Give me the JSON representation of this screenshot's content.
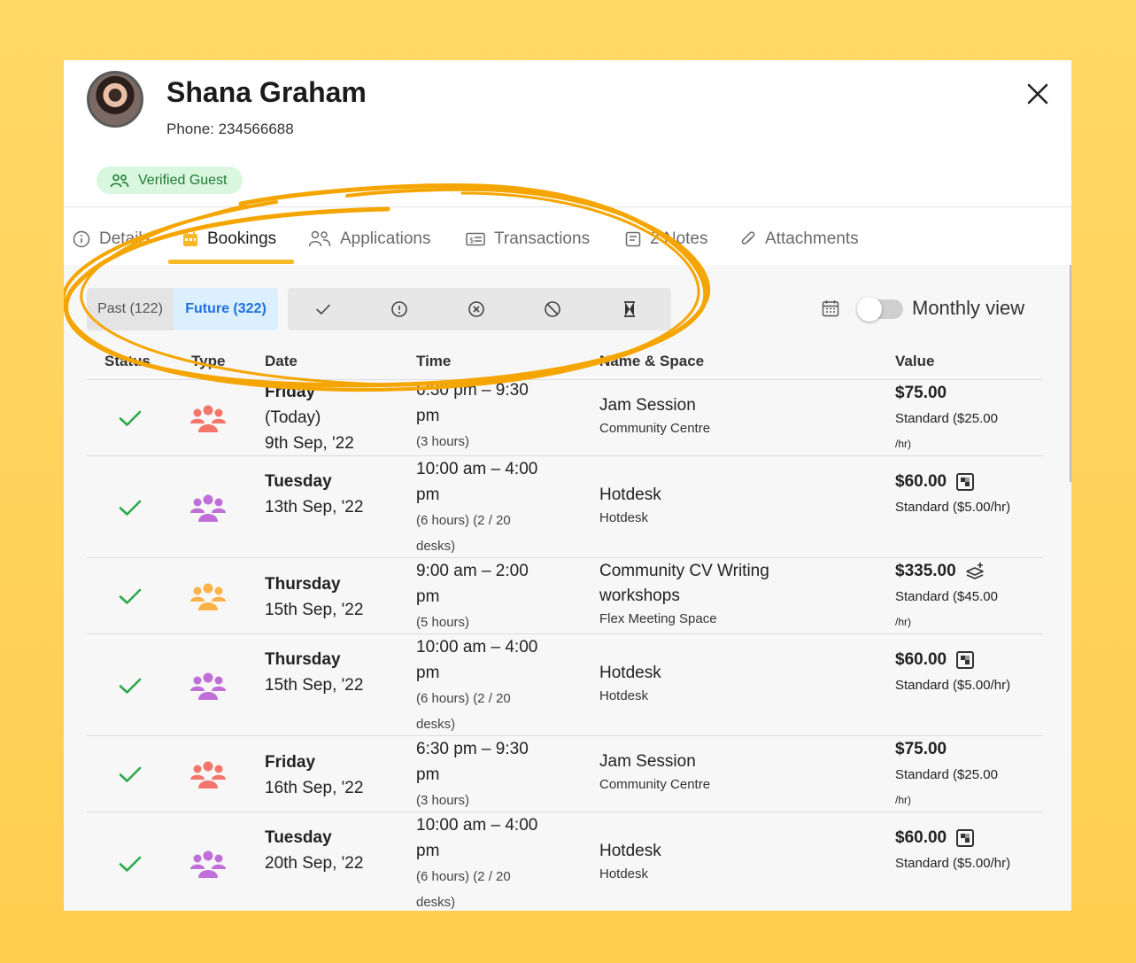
{
  "guest": {
    "name": "Shana Graham",
    "phone": "Phone: 234566688",
    "badge": "Verified Guest"
  },
  "tabs": [
    {
      "label": "Details",
      "icon": "info-icon",
      "active": false
    },
    {
      "label": "Bookings",
      "icon": "calendar-icon",
      "active": true
    },
    {
      "label": "Applications",
      "icon": "users-icon",
      "active": false
    },
    {
      "label": "Transactions",
      "icon": "receipt-icon",
      "active": false
    },
    {
      "label": "2 Notes",
      "icon": "note-icon",
      "active": false
    },
    {
      "label": "Attachments",
      "icon": "paperclip-icon",
      "active": false
    }
  ],
  "filters": {
    "past": "Past (122)",
    "future": "Future (322)",
    "statuses": [
      "check-icon",
      "alert-circle-icon",
      "x-circle-icon",
      "ban-icon",
      "hourglass-icon"
    ],
    "monthly_view": "Monthly view",
    "monthly_view_on": false
  },
  "table": {
    "headers": [
      "Status",
      "Type",
      "Date",
      "Time",
      "Name & Space",
      "Value"
    ],
    "rows": [
      {
        "type_color": "#f4756a",
        "date_lines": [
          "Friday",
          "(Today)",
          "9th Sep, '22"
        ],
        "time_lines": [
          "6:30 pm – 9:30",
          "pm"
        ],
        "time_detail": [
          "(3 hours)"
        ],
        "name": "Jam Session",
        "space": "Community Centre",
        "price": "$75.00",
        "price_icon": "",
        "rate_lines": [
          "Standard  ($25.00",
          "/hr)"
        ]
      },
      {
        "type_color": "#c06fd8",
        "date_lines": [
          "Tuesday",
          "13th Sep, '22"
        ],
        "time_lines": [
          "10:00 am – 4:00",
          "pm"
        ],
        "time_detail": [
          "(6 hours) (2 / 20",
          "desks)"
        ],
        "name": "Hotdesk",
        "space": "Hotdesk",
        "price": "$60.00",
        "price_icon": "desk-icon",
        "rate_lines": [
          "Standard  ($5.00/hr)"
        ]
      },
      {
        "type_color": "#fbb247",
        "date_lines": [
          "Thursday",
          "15th Sep, '22"
        ],
        "time_lines": [
          "9:00 am – 2:00",
          "pm"
        ],
        "time_detail": [
          "(5 hours)"
        ],
        "name": "Community CV Writing workshops",
        "space": "Flex Meeting Space",
        "price": "$335.00",
        "price_icon": "layers-plus-icon",
        "rate_lines": [
          "Standard  ($45.00",
          "/hr)"
        ]
      },
      {
        "type_color": "#c06fd8",
        "date_lines": [
          "Thursday",
          "15th Sep, '22"
        ],
        "time_lines": [
          "10:00 am – 4:00",
          "pm"
        ],
        "time_detail": [
          "(6 hours) (2 / 20",
          "desks)"
        ],
        "name": "Hotdesk",
        "space": "Hotdesk",
        "price": "$60.00",
        "price_icon": "desk-icon",
        "rate_lines": [
          "Standard  ($5.00/hr)"
        ]
      },
      {
        "type_color": "#f4756a",
        "date_lines": [
          "Friday",
          "16th Sep, '22"
        ],
        "time_lines": [
          "6:30 pm – 9:30",
          "pm"
        ],
        "time_detail": [
          "(3 hours)"
        ],
        "name": "Jam Session",
        "space": "Community Centre",
        "price": "$75.00",
        "price_icon": "",
        "rate_lines": [
          "Standard  ($25.00",
          "/hr)"
        ]
      },
      {
        "type_color": "#c06fd8",
        "date_lines": [
          "Tuesday",
          "20th Sep, '22"
        ],
        "time_lines": [
          "10:00 am – 4:00",
          "pm"
        ],
        "time_detail": [
          "(6 hours) (2 / 20",
          "desks)"
        ],
        "name": "Hotdesk",
        "space": "Hotdesk",
        "price": "$60.00",
        "price_icon": "desk-icon",
        "rate_lines": [
          "Standard  ($5.00/hr)"
        ]
      }
    ]
  },
  "colors": {
    "background": "#ffd866",
    "accent": "#f7b928",
    "highlight_ring": "#f5a500",
    "status_success": "#2ea84a",
    "future_text": "#1e6fe0",
    "future_bg": "#dcefff"
  }
}
